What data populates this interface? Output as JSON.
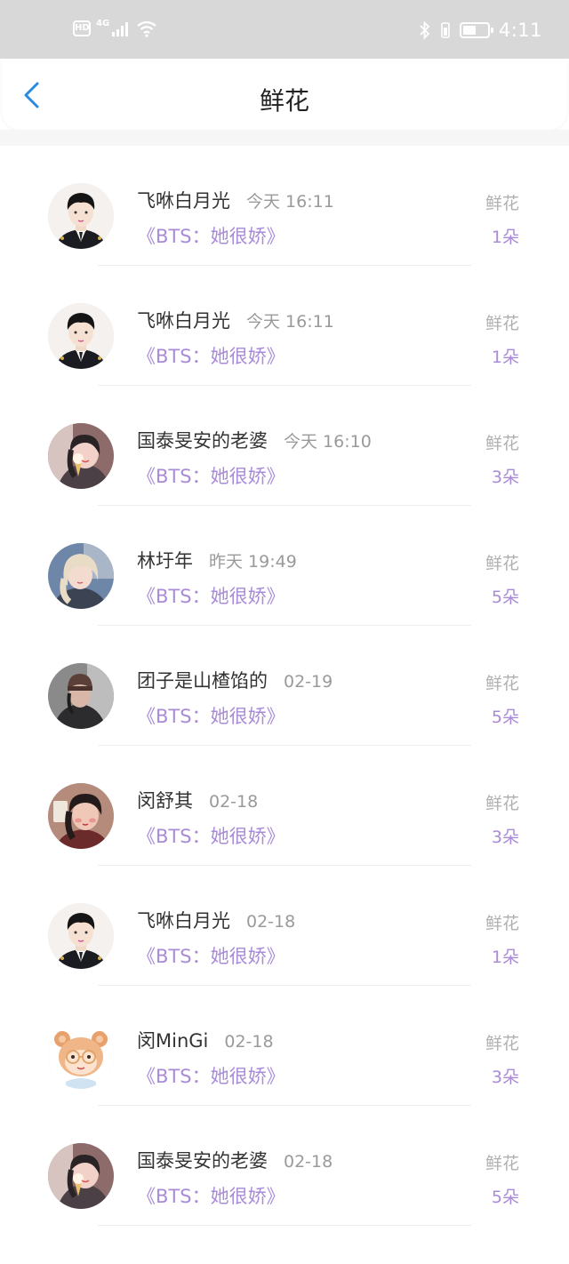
{
  "status_bar": {
    "hd": "HD",
    "network": "4G",
    "time": "4:11"
  },
  "header": {
    "title": "鲜花"
  },
  "rows": [
    {
      "name": "飞咻白月光",
      "time": "今天 16:11",
      "book": "《BTS：她很娇》",
      "gift_label": "鲜花",
      "count": "1朵",
      "avatar": "suit-boy"
    },
    {
      "name": "飞咻白月光",
      "time": "今天 16:11",
      "book": "《BTS：她很娇》",
      "gift_label": "鲜花",
      "count": "1朵",
      "avatar": "suit-boy"
    },
    {
      "name": "国泰旻安的老婆",
      "time": "今天 16:10",
      "book": "《BTS：她很娇》",
      "gift_label": "鲜花",
      "count": "3朵",
      "avatar": "icecream-girl"
    },
    {
      "name": "林圩年",
      "time": "昨天 19:49",
      "book": "《BTS：她很娇》",
      "gift_label": "鲜花",
      "count": "5朵",
      "avatar": "blonde-girl"
    },
    {
      "name": "团子是山楂馅的",
      "time": "02-19",
      "book": "《BTS：她很娇》",
      "gift_label": "鲜花",
      "count": "5朵",
      "avatar": "beanie-person"
    },
    {
      "name": "闵舒其",
      "time": "02-18",
      "book": "《BTS：她很娇》",
      "gift_label": "鲜花",
      "count": "3朵",
      "avatar": "red-girl"
    },
    {
      "name": "飞咻白月光",
      "time": "02-18",
      "book": "《BTS：她很娇》",
      "gift_label": "鲜花",
      "count": "1朵",
      "avatar": "suit-boy"
    },
    {
      "name": "闵MinGi",
      "time": "02-18",
      "book": "《BTS：她很娇》",
      "gift_label": "鲜花",
      "count": "3朵",
      "avatar": "cartoon-bear"
    },
    {
      "name": "国泰旻安的老婆",
      "time": "02-18",
      "book": "《BTS：她很娇》",
      "gift_label": "鲜花",
      "count": "5朵",
      "avatar": "icecream-girl"
    }
  ]
}
